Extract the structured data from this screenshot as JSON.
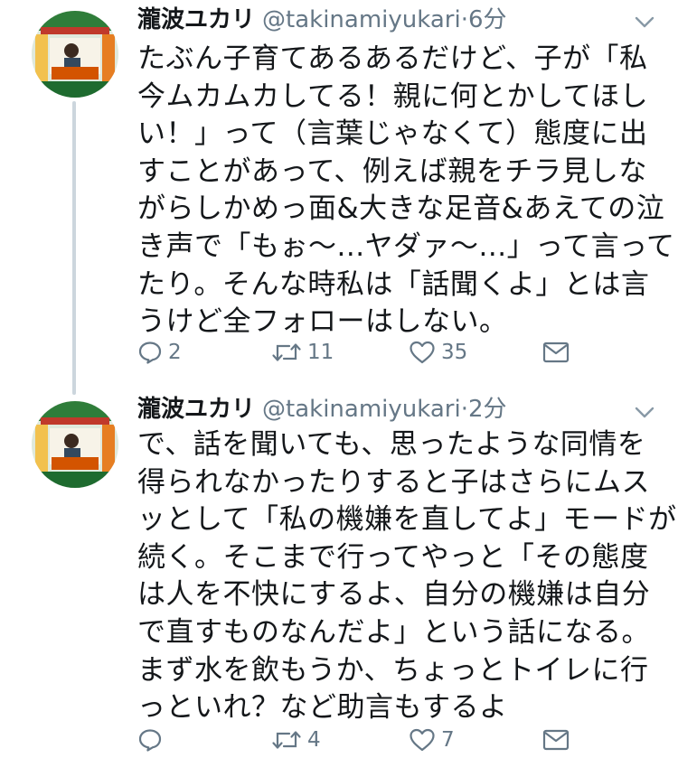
{
  "tweets": [
    {
      "author_name": "瀧波ユカリ",
      "handle": "@takinamiyukari",
      "separator": "·",
      "time": "6分",
      "body": "たぶん子育てあるあるだけど、子が「私\n今ムカムカしてる！親に何とかしてほし\nい！」って（言葉じゃなくて）態度に出\nすことがあって、例えば親をチラ見しな\nがらしかめっ面&大きな足音&あえての泣\nき声で「もぉ〜...ヤダァ〜...」って言って\nたり。そんな時私は「話聞くよ」とは言\nうけど全フォローはしない。",
      "reply_count": "2",
      "retweet_count": "11",
      "like_count": "35",
      "icons": [
        "avatar",
        "chevron-down-icon",
        "reply-icon",
        "retweet-icon",
        "like-icon",
        "direct-message-icon"
      ]
    },
    {
      "author_name": "瀧波ユカリ",
      "handle": "@takinamiyukari",
      "separator": "·",
      "time": "2分",
      "body": "で、話を聞いても、思ったような同情を\n得られなかったりすると子はさらにムス\nッとして「私の機嫌を直してよ」モードが\n続く。そこまで行ってやっと「その態度\nは人を不快にするよ、自分の機嫌は自分\nで直すものなんだよ」という話になる。\nまず水を飲もうか、ちょっとトイレに行\nっといれ？など助言もするよ",
      "reply_count": "",
      "retweet_count": "4",
      "like_count": "7",
      "icons": [
        "avatar",
        "chevron-down-icon",
        "reply-icon",
        "retweet-icon",
        "like-icon",
        "direct-message-icon"
      ]
    }
  ],
  "colors": {
    "text": "#14171a",
    "secondary": "#657786",
    "thread_line": "#ccd6dd"
  }
}
